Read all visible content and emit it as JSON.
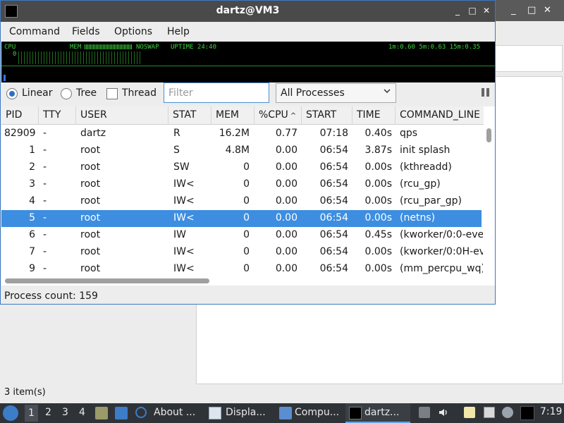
{
  "window": {
    "title": "dartz@VM3",
    "controls": [
      "_",
      "□",
      "✕"
    ]
  },
  "menu": [
    "Command",
    "Fields",
    "Options",
    "Help"
  ],
  "monitor": {
    "cpu_label": "CPU",
    "cpu_value": "0",
    "mem_label": "MEM",
    "swap_label": "NOSWAP",
    "uptime": "UPTIME 24:40",
    "load": "1m:0.60 5m:0.63 15m:0.35"
  },
  "toolbar": {
    "linear": "Linear",
    "tree": "Tree",
    "thread": "Thread",
    "filter_placeholder": "Filter",
    "process_select": "All Processes"
  },
  "table": {
    "columns": [
      "PID",
      "TTY",
      "USER",
      "STAT",
      "MEM",
      "%CPU",
      "START",
      "TIME",
      "COMMAND_LINE"
    ],
    "sort_column": "%CPU",
    "rows": [
      {
        "pid": "82909",
        "tty": "-",
        "user": "dartz",
        "stat": "R",
        "mem": "16.2M",
        "cpu": "0.77",
        "start": "07:18",
        "time": "0.40s",
        "cmd": "qps"
      },
      {
        "pid": "1",
        "tty": "-",
        "user": "root",
        "stat": "S",
        "mem": "4.8M",
        "cpu": "0.00",
        "start": "06:54",
        "time": "3.87s",
        "cmd": "init splash"
      },
      {
        "pid": "2",
        "tty": "-",
        "user": "root",
        "stat": "SW",
        "mem": "0",
        "cpu": "0.00",
        "start": "06:54",
        "time": "0.00s",
        "cmd": "(kthreadd)"
      },
      {
        "pid": "3",
        "tty": "-",
        "user": "root",
        "stat": "IW<",
        "mem": "0",
        "cpu": "0.00",
        "start": "06:54",
        "time": "0.00s",
        "cmd": "(rcu_gp)"
      },
      {
        "pid": "4",
        "tty": "-",
        "user": "root",
        "stat": "IW<",
        "mem": "0",
        "cpu": "0.00",
        "start": "06:54",
        "time": "0.00s",
        "cmd": "(rcu_par_gp)"
      },
      {
        "pid": "5",
        "tty": "-",
        "user": "root",
        "stat": "IW<",
        "mem": "0",
        "cpu": "0.00",
        "start": "06:54",
        "time": "0.00s",
        "cmd": "(netns)"
      },
      {
        "pid": "6",
        "tty": "-",
        "user": "root",
        "stat": "IW",
        "mem": "0",
        "cpu": "0.00",
        "start": "06:54",
        "time": "0.45s",
        "cmd": "(kworker/0:0-eve"
      },
      {
        "pid": "7",
        "tty": "-",
        "user": "root",
        "stat": "IW<",
        "mem": "0",
        "cpu": "0.00",
        "start": "06:54",
        "time": "0.00s",
        "cmd": "(kworker/0:0H-ev"
      },
      {
        "pid": "9",
        "tty": "-",
        "user": "root",
        "stat": "IW<",
        "mem": "0",
        "cpu": "0.00",
        "start": "06:54",
        "time": "0.00s",
        "cmd": "(mm_percpu_wq)"
      }
    ],
    "selected_pid": "5"
  },
  "status": {
    "process_count": "Process count: 159"
  },
  "background": {
    "status_text": "3 item(s)",
    "controls": [
      "_",
      "□",
      "✕"
    ]
  },
  "taskbar": {
    "workspaces": [
      "1",
      "2",
      "3",
      "4"
    ],
    "tasks": [
      {
        "label": "About ..."
      },
      {
        "label": "Displa..."
      },
      {
        "label": "Compu..."
      },
      {
        "label": "dartz..."
      }
    ],
    "clock": "7:19"
  },
  "colors": {
    "selection": "#3d8ee0",
    "title_bar": "#4a4a4a",
    "monitor_green": "#3cd43c",
    "taskbar": "#2f3338"
  }
}
